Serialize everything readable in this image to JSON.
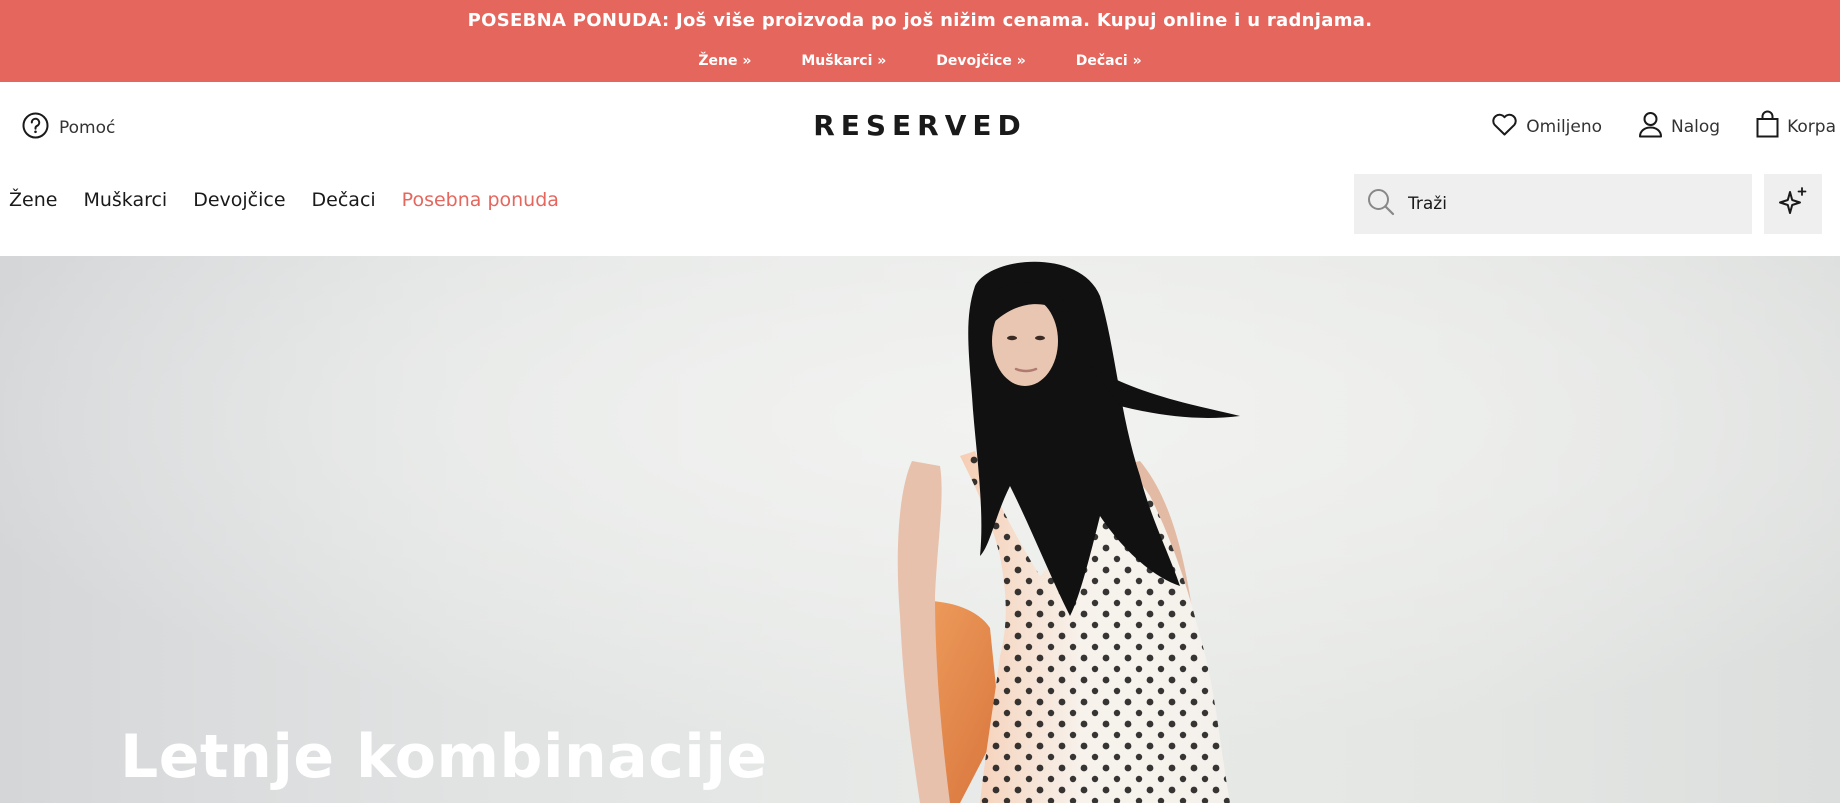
{
  "promo": {
    "text": "POSEBNA PONUDA: Još više proizvoda po još nižim cenama. Kupuj online i u radnjama.",
    "links": [
      "Žene »",
      "Muškarci »",
      "Devojčice »",
      "Dečaci »"
    ],
    "background": "#e5665d"
  },
  "header": {
    "help_label": "Pomoć",
    "logo": "RESERVED",
    "favorites_label": "Omiljeno",
    "account_label": "Nalog",
    "cart_label": "Korpa"
  },
  "nav": {
    "items": [
      "Žene",
      "Muškarci",
      "Devojčice",
      "Dečaci"
    ],
    "special": "Posebna ponuda",
    "accent": "#e5665d"
  },
  "search": {
    "placeholder": "Traži",
    "icon": "search-icon",
    "ai_icon": "sparkle-icon"
  },
  "hero": {
    "title": "Letnje kombinacije"
  }
}
